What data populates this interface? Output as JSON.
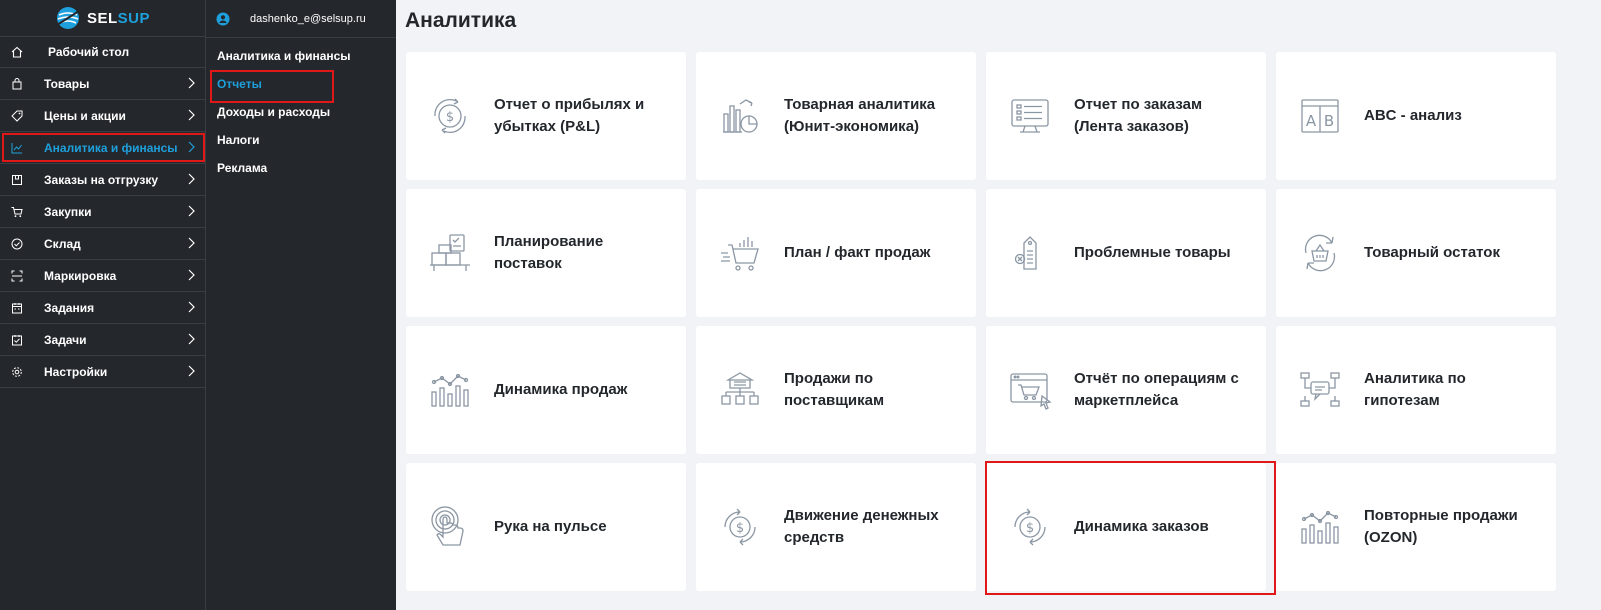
{
  "brand": {
    "logo_text": "SELSUP",
    "accent": "#1ea0dc",
    "highlight": "#e01818"
  },
  "user": {
    "email": "dashenko_e@selsup.ru",
    "icon": "user-circle-icon"
  },
  "sidebar": {
    "items": [
      {
        "label": "Рабочий стол",
        "icon": "home-icon"
      },
      {
        "label": "Товары",
        "icon": "bag-icon"
      },
      {
        "label": "Цены и акции",
        "icon": "tag-icon"
      },
      {
        "label": "Аналитика и финансы",
        "icon": "chart-line-icon",
        "active": true
      },
      {
        "label": "Заказы на отгрузку",
        "icon": "box-icon"
      },
      {
        "label": "Закупки",
        "icon": "cart-icon"
      },
      {
        "label": "Склад",
        "icon": "check-circle-icon"
      },
      {
        "label": "Маркировка",
        "icon": "scan-icon"
      },
      {
        "label": "Задания",
        "icon": "calendar-icon"
      },
      {
        "label": "Задачи",
        "icon": "task-icon"
      },
      {
        "label": "Настройки",
        "icon": "gear-icon"
      }
    ]
  },
  "submenu": {
    "items": [
      {
        "label": "Аналитика и финансы"
      },
      {
        "label": "Отчеты",
        "selected": true
      },
      {
        "label": "Доходы и расходы"
      },
      {
        "label": "Налоги"
      },
      {
        "label": "Реклама"
      }
    ]
  },
  "main": {
    "title": "Аналитика",
    "cards": [
      {
        "label": "Отчет о прибылях и убытках (P&L)",
        "icon": "profit-loss-icon"
      },
      {
        "label": "Товарная аналитика (Юнит-экономика)",
        "icon": "unit-economics-icon"
      },
      {
        "label": "Отчет по заказам (Лента заказов)",
        "icon": "orders-report-icon"
      },
      {
        "label": "ABC - анализ",
        "icon": "abc-icon"
      },
      {
        "label": "Планирование поставок",
        "icon": "supply-planning-icon"
      },
      {
        "label": "План / факт продаж",
        "icon": "sales-plan-icon"
      },
      {
        "label": "Проблемные товары",
        "icon": "problem-goods-icon"
      },
      {
        "label": "Товарный остаток",
        "icon": "stock-balance-icon"
      },
      {
        "label": "Динамика продаж",
        "icon": "sales-dynamics-icon"
      },
      {
        "label": "Продажи по поставщикам",
        "icon": "suppliers-icon"
      },
      {
        "label": "Отчёт по операциям с маркетплейса",
        "icon": "marketplace-ops-icon"
      },
      {
        "label": "Аналитика по гипотезам",
        "icon": "hypotheses-icon"
      },
      {
        "label": "Рука на пульсе",
        "icon": "hand-pulse-icon"
      },
      {
        "label": "Движение денежных средств",
        "icon": "cash-flow-icon"
      },
      {
        "label": "Динамика заказов",
        "icon": "orders-dynamics-icon",
        "highlight": true
      },
      {
        "label": "Повторные продажи (OZON)",
        "icon": "repeat-sales-icon"
      }
    ]
  }
}
